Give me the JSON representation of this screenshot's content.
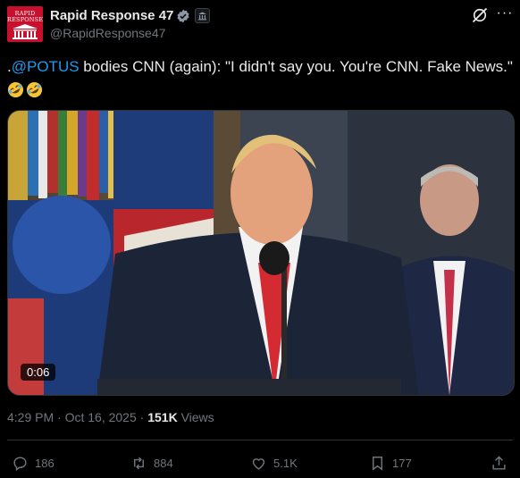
{
  "account": {
    "name": "Rapid Response 47",
    "handle": "@RapidResponse47",
    "avatar_text": "RAPID RESPONSE",
    "verified_icon": "verified-badge-icon",
    "affiliate_icon": "government-building-icon"
  },
  "header_actions": {
    "grok_icon": "grok-icon",
    "more_icon": "more-options-icon"
  },
  "tweet": {
    "prefix": ".",
    "mention": "@POTUS",
    "text": " bodies CNN (again): \"I didn't say you. You're CNN. Fake News.\"",
    "emojis": [
      "rolling-on-floor-laughing-emoji",
      "rolling-on-floor-laughing-emoji"
    ]
  },
  "media": {
    "duration": "0:06"
  },
  "meta": {
    "time": "4:29 PM",
    "separator": "·",
    "date": "Oct 16, 2025",
    "separator2": "·",
    "views_count": "151K",
    "views_label": "Views"
  },
  "actions": {
    "replies": "186",
    "reposts": "884",
    "likes": "5.1K",
    "bookmarks": "177"
  },
  "colors": {
    "background": "#000000",
    "text": "#e7e9ea",
    "secondary": "#71767b",
    "link": "#1d9bf0",
    "avatar": "#c8102e"
  }
}
